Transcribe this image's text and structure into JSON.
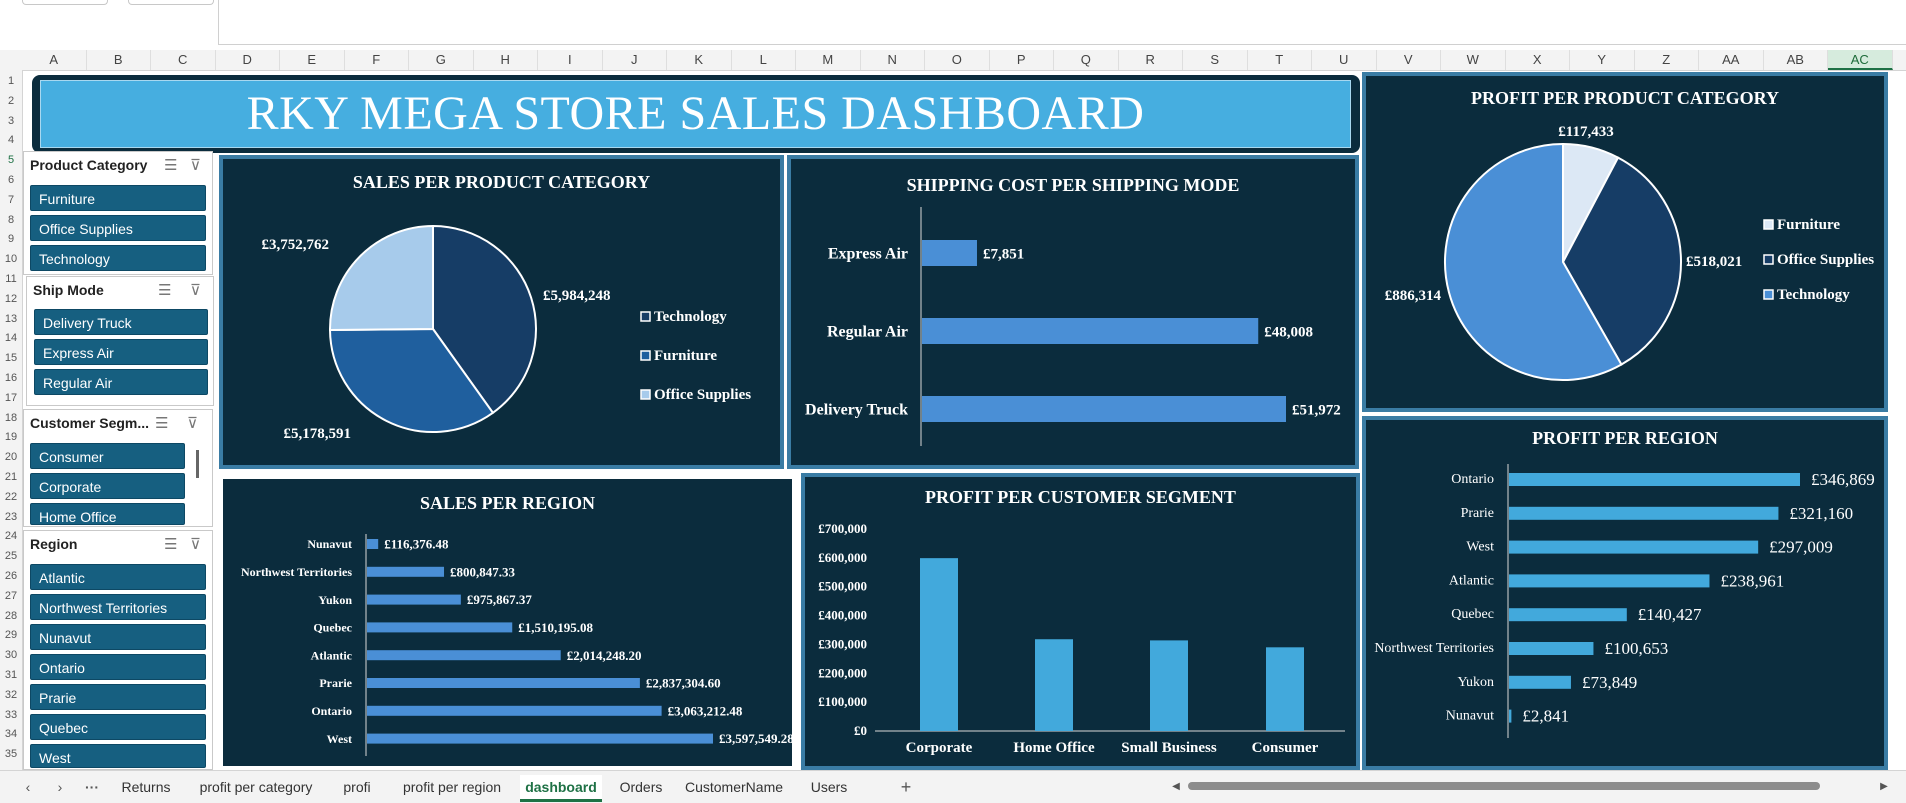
{
  "columns": [
    "A",
    "B",
    "C",
    "D",
    "E",
    "F",
    "G",
    "H",
    "I",
    "J",
    "K",
    "L",
    "M",
    "N",
    "O",
    "P",
    "Q",
    "R",
    "S",
    "T",
    "U",
    "V",
    "W",
    "X",
    "Y",
    "Z",
    "AA",
    "AB",
    "AC"
  ],
  "selected_column": "AC",
  "rows": [
    "1",
    "2",
    "3",
    "4",
    "5",
    "6",
    "7",
    "8",
    "9",
    "10",
    "11",
    "12",
    "13",
    "14",
    "15",
    "16",
    "17",
    "18",
    "19",
    "20",
    "21",
    "22",
    "23",
    "24",
    "25",
    "26",
    "27",
    "28",
    "29",
    "30",
    "31",
    "32",
    "33",
    "34",
    "35"
  ],
  "selected_row": "5",
  "dashboard_title": "RKY MEGA STORE SALES DASHBOARD",
  "slicers": [
    {
      "title": "Product Category",
      "items": [
        "Furniture",
        "Office Supplies",
        "Technology"
      ]
    },
    {
      "title": "Ship Mode",
      "items": [
        "Delivery Truck",
        "Express Air",
        "Regular Air"
      ]
    },
    {
      "title": "Customer Segm...",
      "items": [
        "Consumer",
        "Corporate",
        "Home Office"
      ]
    },
    {
      "title": "Region",
      "items": [
        "Atlantic",
        "Northwest Territories",
        "Nunavut",
        "Ontario",
        "Prarie",
        "Quebec",
        "West"
      ]
    }
  ],
  "colors": {
    "panel_bg": "#0b2c3d",
    "panel_border": "#3a7ca4",
    "title_bg": "#46aee0",
    "bar_blue": "#4a8fd6",
    "bar_light": "#42a9dc",
    "slicer_item": "#165f80"
  },
  "tabs": [
    "Returns",
    "profit per category",
    "profi",
    "profit per region",
    "dashboard",
    "Orders",
    "CustomerName",
    "Users"
  ],
  "active_tab": "dashboard",
  "chart_data": [
    {
      "type": "pie",
      "title": "SALES PER PRODUCT CATEGORY",
      "categories": [
        "Technology",
        "Furniture",
        "Office Supplies"
      ],
      "values": [
        5984248,
        5178591,
        3752762
      ],
      "labels": [
        "£5,984,248",
        "£5,178,591",
        "£3,752,762"
      ],
      "colors": [
        "#163d66",
        "#1f5f9e",
        "#a7cbeb"
      ],
      "legend": "right"
    },
    {
      "type": "bar",
      "orientation": "horizontal",
      "title": "SHIPPING COST PER SHIPPING MODE",
      "categories": [
        "Express Air",
        "Regular Air",
        "Delivery Truck"
      ],
      "values": [
        7851,
        48008,
        51972
      ],
      "labels": [
        "£7,851",
        "£48,008",
        "£51,972"
      ]
    },
    {
      "type": "pie",
      "title": "PROFIT PER PRODUCT CATEGORY",
      "categories": [
        "Furniture",
        "Office Supplies",
        "Technology"
      ],
      "values": [
        117433,
        518021,
        886314
      ],
      "labels": [
        "£117,433",
        "£518,021",
        "£886,314"
      ],
      "colors": [
        "#dce8f5",
        "#163d66",
        "#4a8fd6"
      ],
      "legend": "right"
    },
    {
      "type": "bar",
      "orientation": "horizontal",
      "title": "SALES PER REGION",
      "categories": [
        "Nunavut",
        "Northwest Territories",
        "Yukon",
        "Quebec",
        "Atlantic",
        "Prarie",
        "Ontario",
        "West"
      ],
      "values": [
        116376.48,
        800847.33,
        975867.37,
        1510195.08,
        2014248.2,
        2837304.6,
        3063212.48,
        3597549.28
      ],
      "labels": [
        "£116,376.48",
        "£800,847.33",
        "£975,867.37",
        "£1,510,195.08",
        "£2,014,248.20",
        "£2,837,304.60",
        "£3,063,212.48",
        "£3,597,549.28"
      ]
    },
    {
      "type": "bar",
      "title": "PROFIT PER CUSTOMER SEGMENT",
      "categories": [
        "Corporate",
        "Home Office",
        "Small Business",
        "Consumer"
      ],
      "values": [
        599000,
        318000,
        314000,
        290000
      ],
      "ylim": [
        0,
        700000
      ],
      "yticks": [
        "£0",
        "£100,000",
        "£200,000",
        "£300,000",
        "£400,000",
        "£500,000",
        "£600,000",
        "£700,000"
      ]
    },
    {
      "type": "bar",
      "orientation": "horizontal",
      "title": "PROFIT PER REGION",
      "categories": [
        "Ontario",
        "Prarie",
        "West",
        "Atlantic",
        "Quebec",
        "Northwest Territories",
        "Yukon",
        "Nunavut"
      ],
      "values": [
        346869,
        321160,
        297009,
        238961,
        140427,
        100653,
        73849,
        2841
      ],
      "labels": [
        "£346,869",
        "£321,160",
        "£297,009",
        "£238,961",
        "£140,427",
        "£100,653",
        "£73,849",
        "£2,841"
      ]
    }
  ]
}
